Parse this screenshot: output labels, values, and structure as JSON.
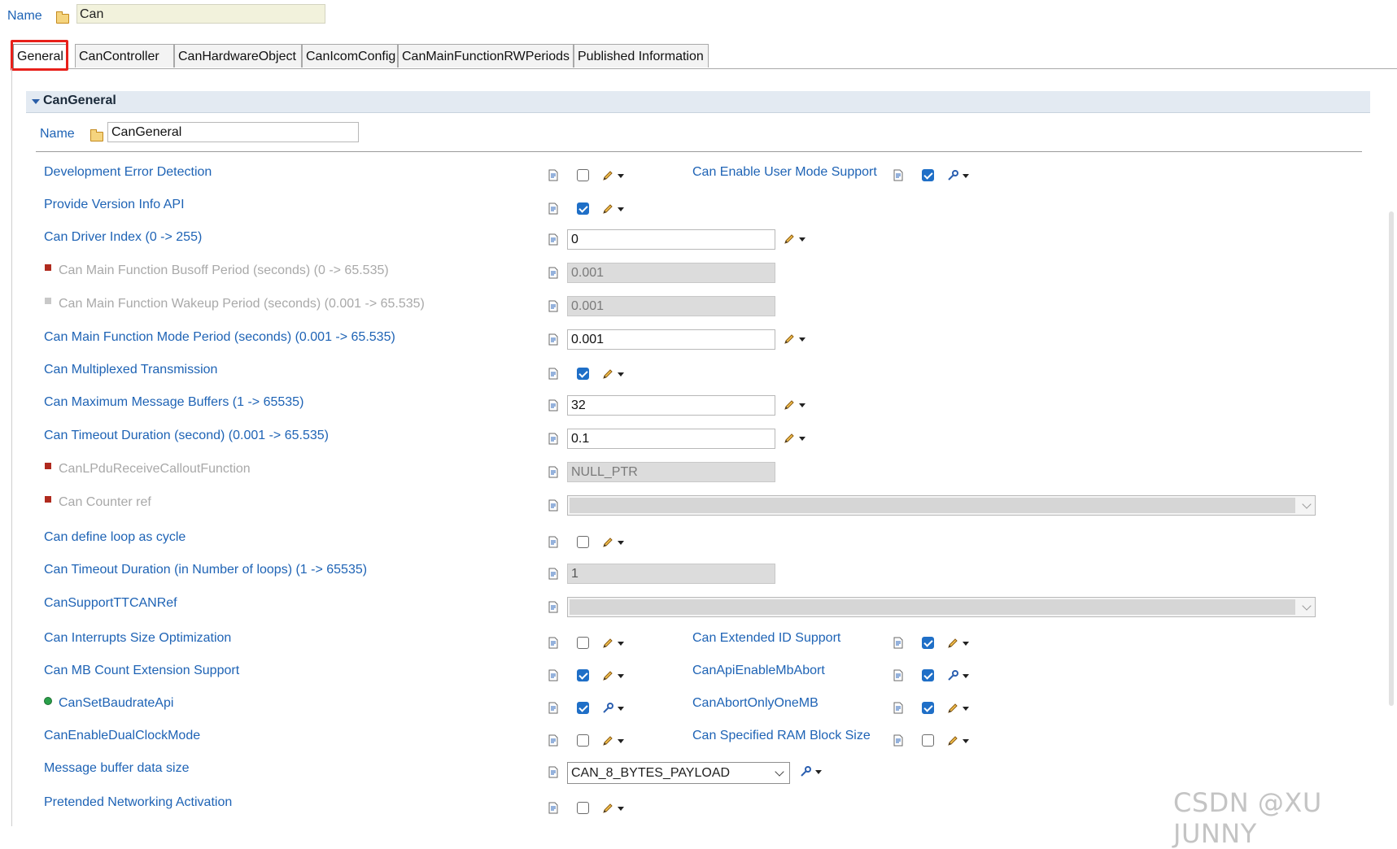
{
  "top": {
    "name_label": "Name",
    "name_value": "Can"
  },
  "tabs": [
    {
      "label": "General",
      "active": true
    },
    {
      "label": "CanController",
      "active": false
    },
    {
      "label": "CanHardwareObject",
      "active": false
    },
    {
      "label": "CanIcomConfig",
      "active": false
    },
    {
      "label": "CanMainFunctionRWPeriods",
      "active": false
    },
    {
      "label": "Published Information",
      "active": false
    }
  ],
  "section": {
    "title": "CanGeneral",
    "name_label": "Name",
    "name_value": "CanGeneral"
  },
  "params": {
    "dev_error": {
      "label": "Development Error Detection",
      "checked": false
    },
    "enable_user_mode": {
      "label": "Can Enable User Mode Support",
      "checked": true
    },
    "version_info": {
      "label": "Provide Version Info API",
      "checked": true
    },
    "driver_index": {
      "label": "Can Driver Index (0 -> 255)",
      "value": "0"
    },
    "busoff_period": {
      "label": "Can Main Function Busoff Period (seconds) (0 -> 65.535)",
      "value": "0.001",
      "disabled": true
    },
    "wakeup_period": {
      "label": "Can Main Function Wakeup Period (seconds) (0.001 -> 65.535)",
      "value": "0.001",
      "disabled": true
    },
    "mode_period": {
      "label": "Can Main Function Mode Period (seconds) (0.001 -> 65.535)",
      "value": "0.001"
    },
    "multiplexed": {
      "label": "Can Multiplexed Transmission",
      "checked": true
    },
    "max_msg_buffers": {
      "label": "Can Maximum Message Buffers (1 -> 65535)",
      "value": "32"
    },
    "timeout_duration": {
      "label": "Can Timeout Duration (second) (0.001 -> 65.535)",
      "value": "0.1"
    },
    "lpdu_callout": {
      "label": "CanLPduReceiveCalloutFunction",
      "value": "NULL_PTR",
      "disabled": true
    },
    "counter_ref": {
      "label": "Can Counter ref",
      "disabled": true
    },
    "loop_as_cycle": {
      "label": "Can define loop as cycle",
      "checked": false
    },
    "timeout_loops": {
      "label": "Can Timeout Duration (in Number of loops) (1 -> 65535)",
      "value": "1"
    },
    "ttcan_ref": {
      "label": "CanSupportTTCANRef"
    },
    "interrupts_opt": {
      "label": "Can Interrupts Size Optimization",
      "checked": false
    },
    "extended_id": {
      "label": "Can Extended ID Support",
      "checked": true
    },
    "mb_count_ext": {
      "label": "Can MB Count Extension Support",
      "checked": true
    },
    "api_mb_abort": {
      "label": "CanApiEnableMbAbort",
      "checked": true
    },
    "set_baudrate": {
      "label": "CanSetBaudrateApi",
      "checked": true
    },
    "abort_one_mb": {
      "label": "CanAbortOnlyOneMB",
      "checked": true
    },
    "dual_clock": {
      "label": "CanEnableDualClockMode",
      "checked": false
    },
    "ram_block": {
      "label": "Can Specified RAM Block Size",
      "checked": false
    },
    "msg_buffer_size": {
      "label": "Message buffer data size",
      "value": "CAN_8_BYTES_PAYLOAD"
    },
    "pretended_net": {
      "label": "Pretended Networking Activation",
      "checked": false
    }
  },
  "icons": {
    "folder": "folder-icon",
    "doc": "document-icon",
    "pencil": "pencil-icon",
    "config": "configure-icon"
  },
  "colors": {
    "link": "#1e63b5",
    "check_on": "#1f6fc7",
    "highlight": "#e8201a",
    "disabled_marker": "#b02a1e"
  },
  "watermark": "CSDN @XU JUNNY"
}
